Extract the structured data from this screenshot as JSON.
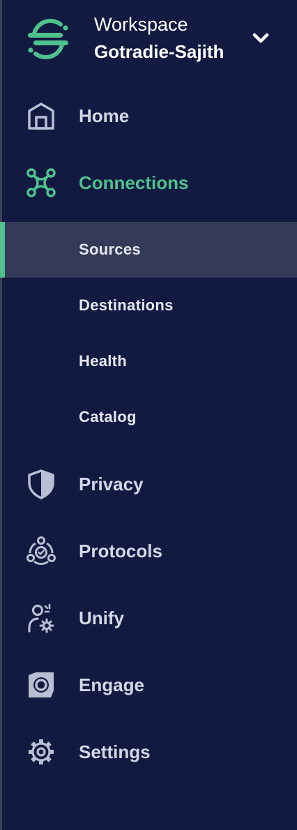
{
  "workspace": {
    "label": "Workspace",
    "name": "Gotradie-Sajith",
    "logo_icon": "segment-logo-icon",
    "toggle_icon": "chevron-down-icon"
  },
  "colors": {
    "background": "#121a41",
    "accent": "#4fc18d",
    "selected_bg": "#343b59",
    "text": "#d4d8e6",
    "icon": "#b9bfd3"
  },
  "nav": {
    "home": {
      "label": "Home",
      "icon": "home-icon"
    },
    "connections": {
      "label": "Connections",
      "icon": "connections-icon",
      "active": true,
      "children": [
        {
          "label": "Sources",
          "selected": true
        },
        {
          "label": "Destinations"
        },
        {
          "label": "Health"
        },
        {
          "label": "Catalog"
        }
      ]
    },
    "privacy": {
      "label": "Privacy",
      "icon": "shield-icon"
    },
    "protocols": {
      "label": "Protocols",
      "icon": "protocols-icon"
    },
    "unify": {
      "label": "Unify",
      "icon": "unify-icon"
    },
    "engage": {
      "label": "Engage",
      "icon": "engage-icon"
    },
    "settings": {
      "label": "Settings",
      "icon": "gear-icon"
    }
  }
}
